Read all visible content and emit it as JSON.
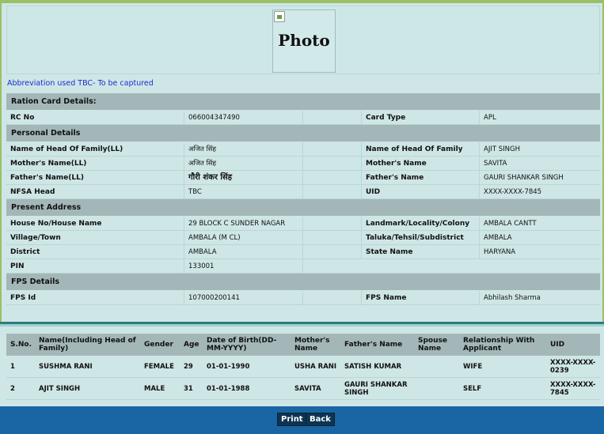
{
  "photo": {
    "label": "Photo"
  },
  "abbreviation_note": "Abbreviation used TBC- To be captured",
  "ration_card": {
    "heading": "Ration Card Details:",
    "rc_no_label": "RC No",
    "rc_no": "066004347490",
    "card_type_label": "Card Type",
    "card_type": "APL"
  },
  "personal": {
    "heading": "Personal Details",
    "rows": [
      {
        "l1": "Name of Head Of Family(LL)",
        "v1": "अजित सिंह",
        "l2": "Name of Head Of Family",
        "v2": "AJIT SINGH"
      },
      {
        "l1": "Mother's Name(LL)",
        "v1": "अजित सिंह",
        "l2": "Mother's Name",
        "v2": "SAVITA"
      },
      {
        "l1": "Father's Name(LL)",
        "v1": "गौरी शंकर सिंह",
        "l2": "Father's Name",
        "v2": "GAURI SHANKAR SINGH"
      },
      {
        "l1": "NFSA Head",
        "v1": "TBC",
        "l2": "UID",
        "v2": "XXXX-XXXX-7845"
      }
    ]
  },
  "address": {
    "heading": "Present Address",
    "rows": [
      {
        "l1": "House No/House Name",
        "v1": "29 BLOCK C SUNDER NAGAR",
        "l2": "Landmark/Locality/Colony",
        "v2": "AMBALA CANTT"
      },
      {
        "l1": "Village/Town",
        "v1": "AMBALA (M CL)",
        "l2": "Taluka/Tehsil/Subdistrict",
        "v2": "AMBALA"
      },
      {
        "l1": "District",
        "v1": "AMBALA",
        "l2": "State Name",
        "v2": "HARYANA"
      },
      {
        "l1": "PIN",
        "v1": "133001",
        "l2": "",
        "v2": ""
      }
    ]
  },
  "fps": {
    "heading": "FPS Details",
    "fps_id_label": "FPS Id",
    "fps_id": "107000200141",
    "fps_name_label": "FPS Name",
    "fps_name": "Abhilash Sharma"
  },
  "members": {
    "headers": [
      "S.No.",
      "Name(Including Head of Family)",
      "Gender",
      "Age",
      "Date of Birth(DD-MM-YYYY)",
      "Mother's Name",
      "Father's Name",
      "Spouse Name",
      "Relationship With Applicant",
      "UID"
    ],
    "rows": [
      [
        "1",
        "SUSHMA RANI",
        "FEMALE",
        "29",
        "01-01-1990",
        "USHA RANI",
        "SATISH KUMAR",
        "",
        "WIFE",
        "XXXX-XXXX-0239"
      ],
      [
        "2",
        "AJIT SINGH",
        "MALE",
        "31",
        "01-01-1988",
        "SAVITA",
        "GAURI SHANKAR SINGH",
        "",
        "SELF",
        "XXXX-XXXX-7845"
      ]
    ]
  },
  "buttons": {
    "print": "Print",
    "back": "Back"
  }
}
